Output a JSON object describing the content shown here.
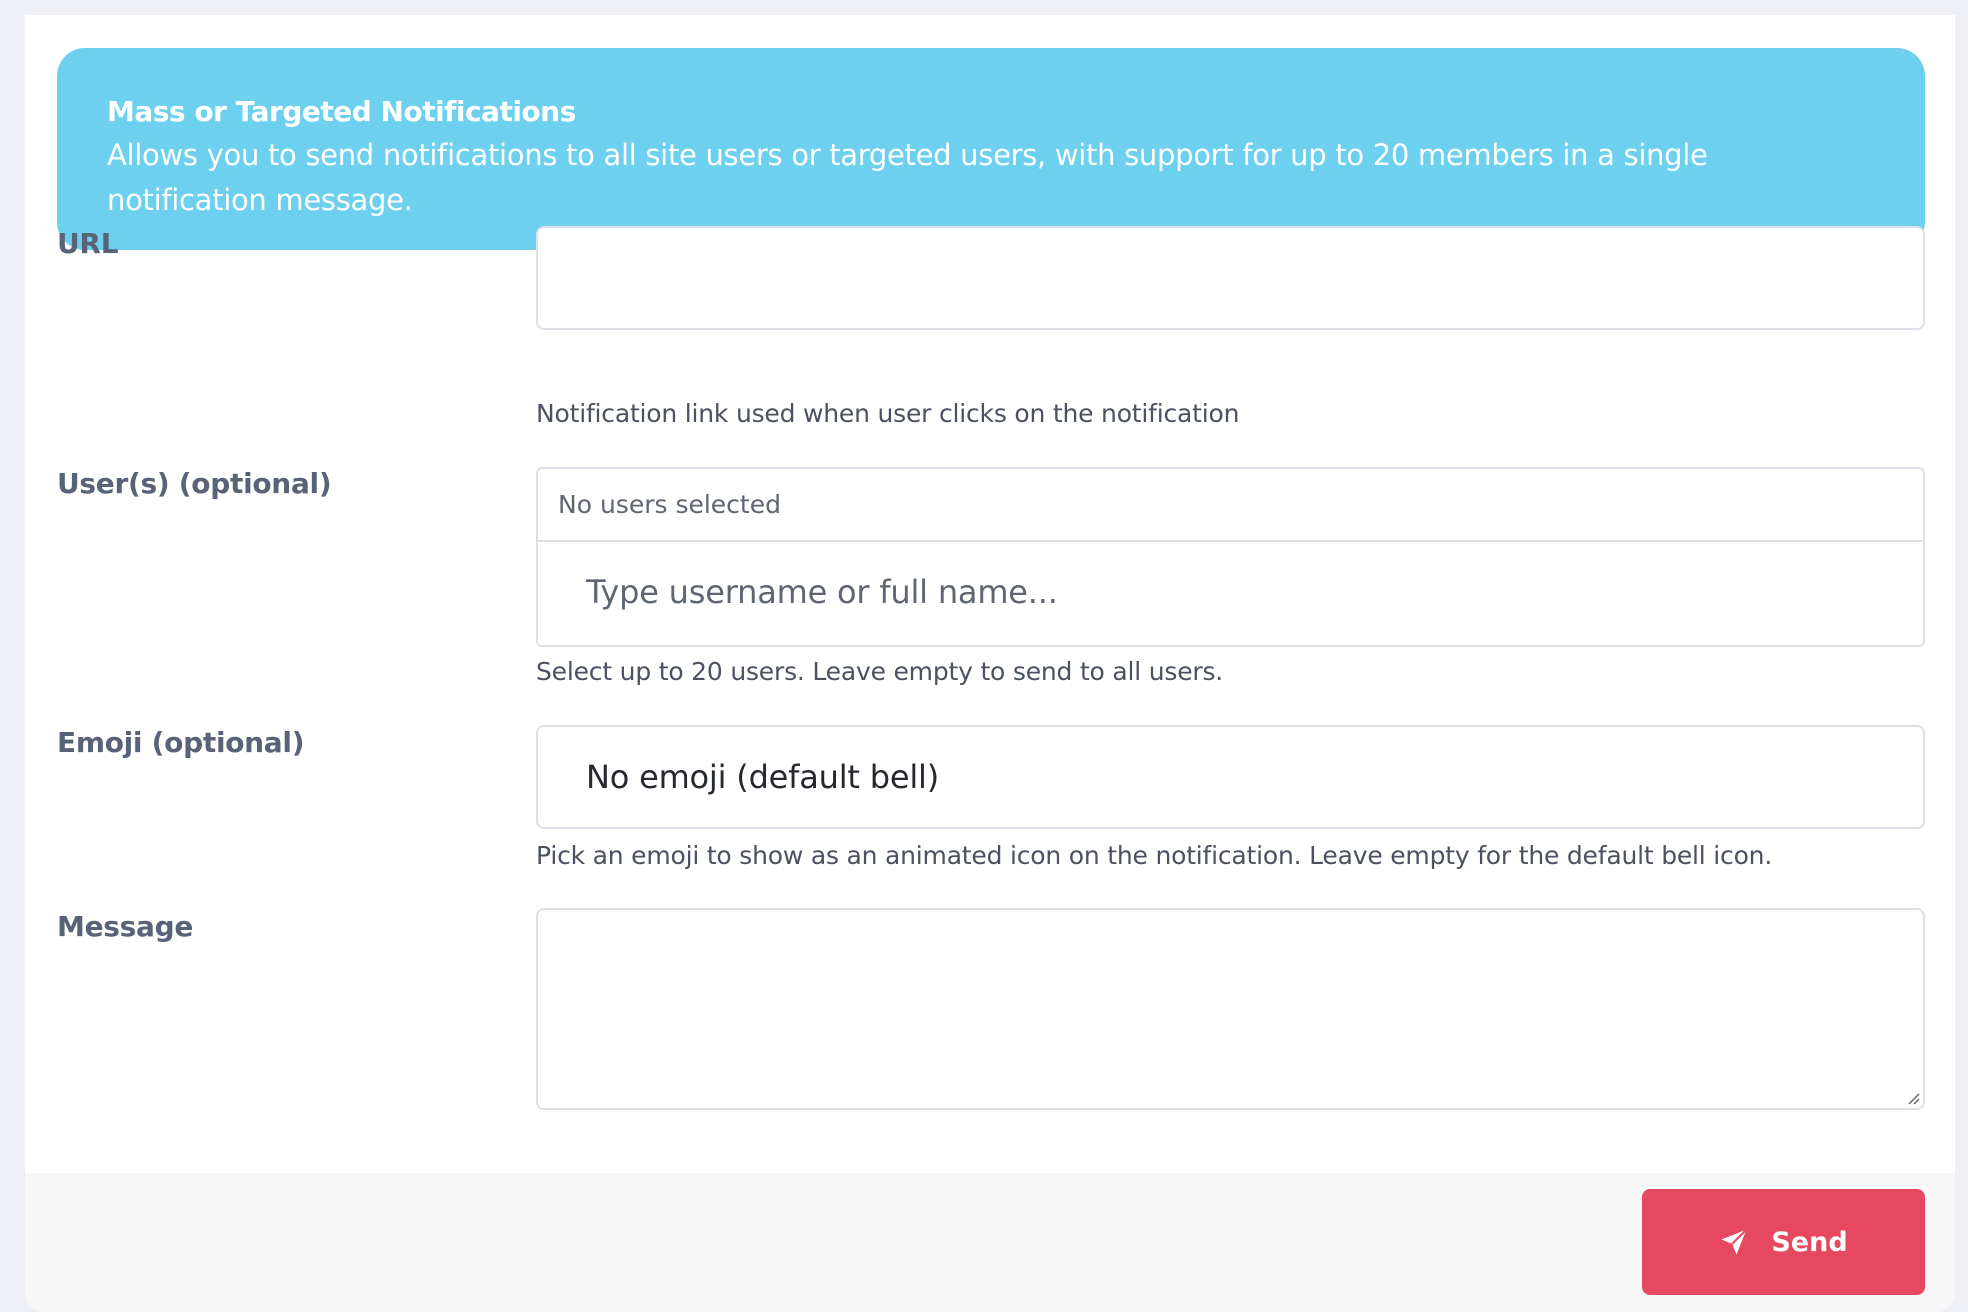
{
  "banner": {
    "title": "Mass or Targeted Notifications",
    "text": "Allows you to send notifications to all site users or targeted users, with support for up to 20 members in a single notification message."
  },
  "form": {
    "url": {
      "label": "URL",
      "value": "",
      "help": "Notification link used when user clicks on the notification"
    },
    "users": {
      "label": "User(s) (optional)",
      "selected_text": "No users selected",
      "search_placeholder": "Type username or full name...",
      "help": "Select up to 20 users. Leave empty to send to all users."
    },
    "emoji": {
      "label": "Emoji (optional)",
      "selected": "No emoji (default bell)",
      "help": "Pick an emoji to show as an animated icon on the notification. Leave empty for the default bell icon."
    },
    "message": {
      "label": "Message",
      "value": ""
    }
  },
  "footer": {
    "send_label": "Send",
    "send_icon": "paper-plane-icon"
  },
  "colors": {
    "banner_bg": "#6cd0ee",
    "send_bg": "#e5485f",
    "label_color": "#586378"
  }
}
